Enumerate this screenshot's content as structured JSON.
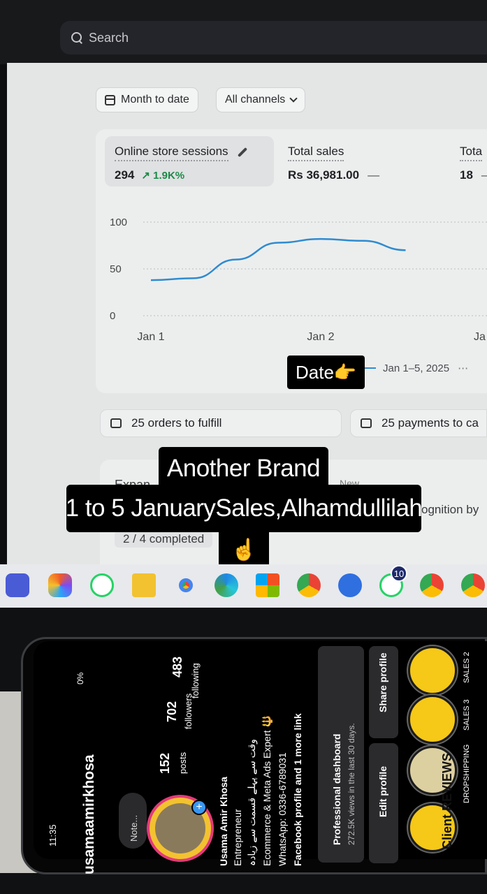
{
  "search": {
    "placeholder": "Search"
  },
  "filters": {
    "date_range": "Month to date",
    "channels": "All channels"
  },
  "metrics": [
    {
      "label": "Online store sessions",
      "value": "294",
      "delta": "1.9K%"
    },
    {
      "label": "Total sales",
      "value": "Rs 36,981.00",
      "delta": "—"
    },
    {
      "label": "Tota",
      "value": "18",
      "delta": "—"
    }
  ],
  "chart_data": {
    "type": "line",
    "x_ticks": [
      "Jan 1",
      "Jan 2",
      "Ja"
    ],
    "y_ticks": [
      "100",
      "50",
      "0"
    ],
    "ylim": [
      0,
      100
    ],
    "series": [
      {
        "name": "Jan 1–5, 2025",
        "x": [
          0,
          0.25,
          0.5,
          0.75,
          1,
          1.25,
          1.5
        ],
        "values": [
          38,
          40,
          60,
          78,
          82,
          80,
          70
        ]
      }
    ],
    "legend": "Jan 1–5, 2025"
  },
  "overlays": {
    "date_tag": "Date👉",
    "line1": "Another Brand",
    "line2": "1 to 5 JanuarySales,Alhamdullilah",
    "pointer": "☝️"
  },
  "tasks": {
    "orders": "25 orders to fulfill",
    "payments": "25 payments to ca"
  },
  "bottom_card": {
    "title_partial": "Expan",
    "badge": "New",
    "right_text": "ognition by",
    "progress": "2 / 4 completed"
  },
  "taskbar": {
    "badge_count": "10"
  },
  "phone": {
    "time": "11:35",
    "battery": "0%",
    "username": "usamaamirkhosa",
    "note": "Note...",
    "posts_count": "152",
    "posts_label": "posts",
    "followers_count": "702",
    "followers_label": "followers",
    "following_count": "483",
    "following_label": "following",
    "bio": [
      "Usama Amir Khosa",
      "Entrepreneur",
      "وقت سے پہلے قسمت سے زیادہ",
      "Ecommerce & Meta Ads Expert 🔱",
      "WhatsApp: 0336-6789031",
      "Facebook profile and 1 more link"
    ],
    "dashboard_title": "Professional dashboard",
    "dashboard_sub": "272.5K views in the last 30 days.",
    "edit_profile": "Edit profile",
    "share_profile": "Share profile",
    "highlights": [
      "SALES 2",
      "SALES 3",
      "DROPSHIPPING",
      "Client REVIEWS"
    ]
  },
  "colors": {
    "accent_line": "#2f8bd0",
    "positive": "#1e8a4a",
    "highlight": "#f6c817"
  }
}
